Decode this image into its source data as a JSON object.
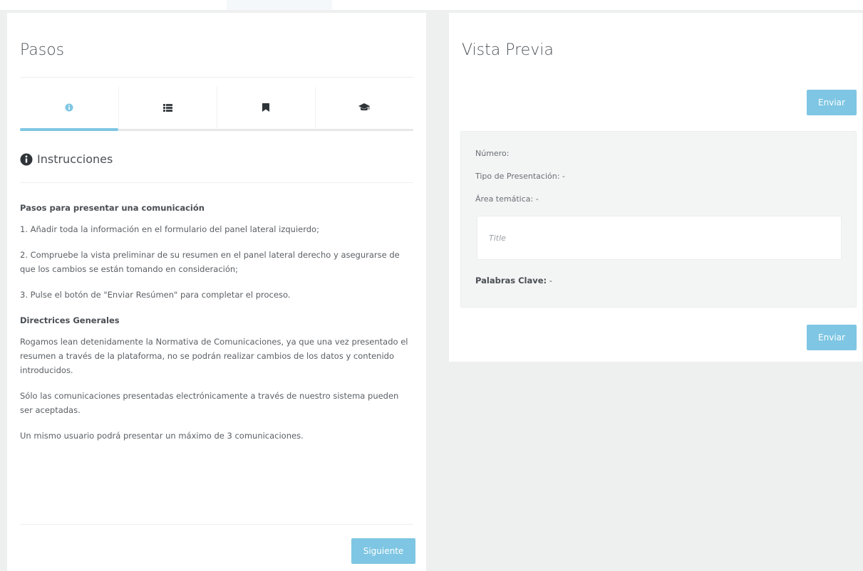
{
  "left": {
    "title": "Pasos",
    "tabs": [
      {
        "icon": "info-circle-icon"
      },
      {
        "icon": "list-icon"
      },
      {
        "icon": "bookmark-icon"
      },
      {
        "icon": "graduation-cap-icon"
      }
    ],
    "section_title": "Instrucciones",
    "steps_heading": "Pasos para presentar una comunicación",
    "step1": "1. Añadir toda la información en el formulario del panel lateral izquierdo;",
    "step2": "2. Compruebe la vista preliminar de su resumen en el panel lateral derecho y asegurarse de que los cambios se están tomando en consideración;",
    "step3": "3. Pulse el botón de \"Enviar Resúmen\" para completar el proceso.",
    "guidelines_heading": "Directrices Generales",
    "guideline1": "Rogamos lean detenidamente la Normativa de Comunicaciones, ya que una vez presentado el resumen a través de la plataforma, no se podrán realizar cambios de los datos y contenido introducidos.",
    "guideline2": "Sólo las comunicaciones presentadas electrónicamente a través de nuestro sistema pueden ser aceptadas.",
    "guideline3": "Un mismo usuario podrá presentar un máximo de 3 comunicaciones.",
    "next_label": "Siguiente"
  },
  "right": {
    "title": "Vista Previa",
    "send_label": "Enviar",
    "numero_label": "Número:",
    "tipo_label": "Tipo de Presentación: -",
    "area_label": "Área temática: -",
    "title_placeholder": "Title",
    "keywords_label": "Palabras Clave:",
    "keywords_value": " -"
  },
  "colors": {
    "accent": "#7ec6e3",
    "background": "#eef0ef",
    "panel": "#ffffff"
  }
}
